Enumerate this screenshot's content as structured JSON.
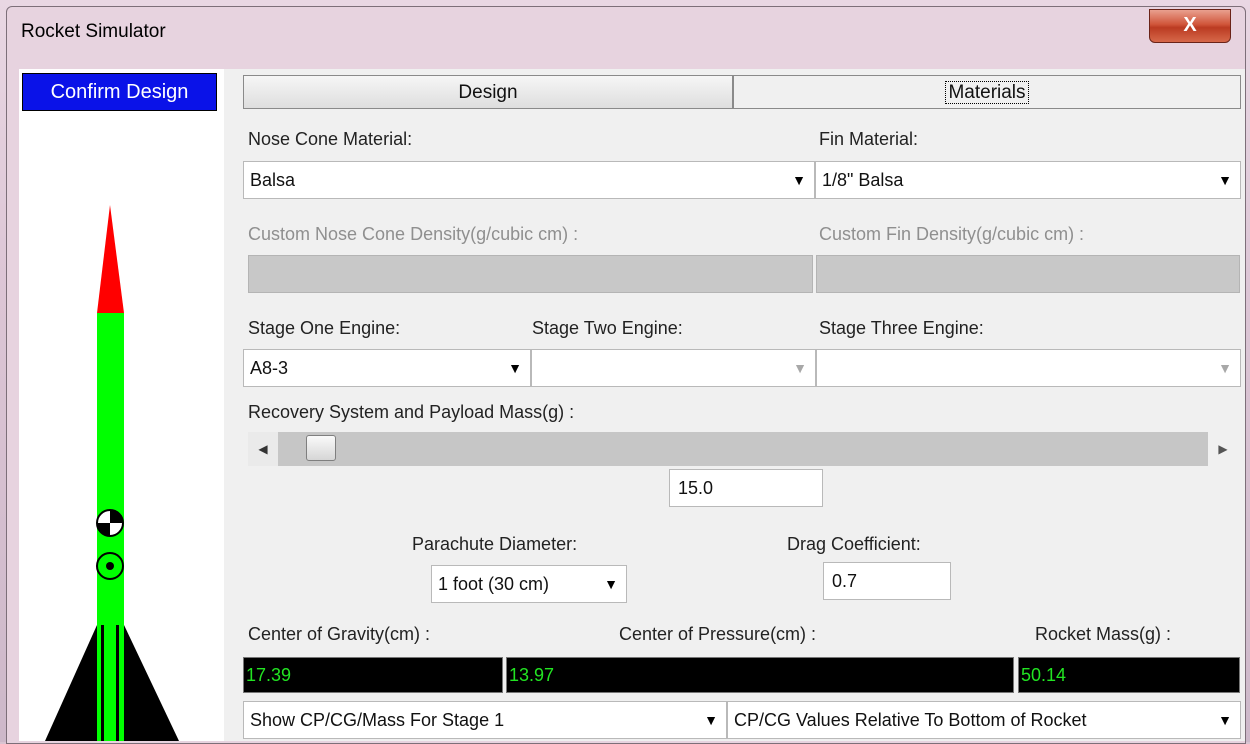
{
  "window": {
    "title": "Rocket Simulator",
    "close_glyph": "X"
  },
  "left_panel": {
    "confirm_label": "Confirm Design"
  },
  "tabs": [
    {
      "label": "Design"
    },
    {
      "label": "Materials"
    }
  ],
  "nose_cone": {
    "label": "Nose Cone Material:",
    "value": "Balsa"
  },
  "fin": {
    "label": "Fin Material:",
    "value": "1/8\" Balsa"
  },
  "custom_nose_density": {
    "label": "Custom Nose Cone Density(g/cubic cm) :",
    "value": ""
  },
  "custom_fin_density": {
    "label": "Custom Fin Density(g/cubic cm) :",
    "value": ""
  },
  "engines": {
    "stage_one": {
      "label": "Stage One Engine:",
      "value": "A8-3"
    },
    "stage_two": {
      "label": "Stage Two Engine:",
      "value": ""
    },
    "stage_three": {
      "label": "Stage Three Engine:",
      "value": ""
    }
  },
  "recovery": {
    "label": "Recovery System and Payload Mass(g) :",
    "value": "15.0"
  },
  "parachute": {
    "label": "Parachute Diameter:",
    "value": "1 foot (30 cm)"
  },
  "drag": {
    "label": "Drag Coefficient:",
    "value": "0.7"
  },
  "results": {
    "cg_label": "Center of Gravity(cm) :",
    "cg_value": "17.39",
    "cp_label": "Center of Pressure(cm) :",
    "cp_value": "13.97",
    "mass_label": "Rocket Mass(g) :",
    "mass_value": "50.14"
  },
  "bottom": {
    "stage_select": "Show CP/CG/Mass For Stage 1",
    "reference_select": "CP/CG Values Relative To Bottom of Rocket"
  },
  "colors": {
    "confirm_bg": "#0a12e8",
    "nose": "#ff0000",
    "body": "#00ff00",
    "fins": "#000000",
    "output_text": "#22e422"
  }
}
